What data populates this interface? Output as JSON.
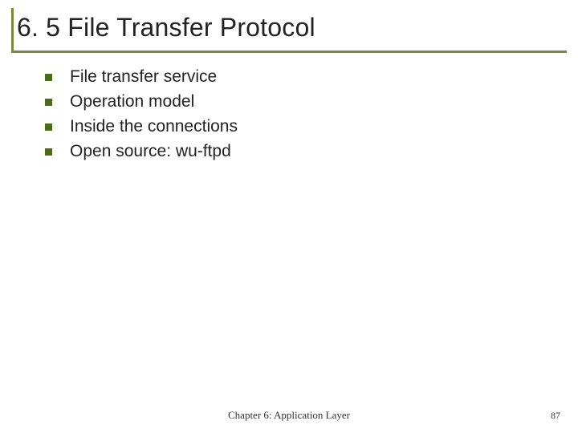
{
  "slide": {
    "title": "6. 5 File Transfer Protocol",
    "bullets": [
      "File transfer service",
      "Operation model",
      "Inside the connections",
      "Open source: wu-ftpd"
    ],
    "footer_center": "Chapter 6: Application Layer",
    "footer_number": "87"
  }
}
